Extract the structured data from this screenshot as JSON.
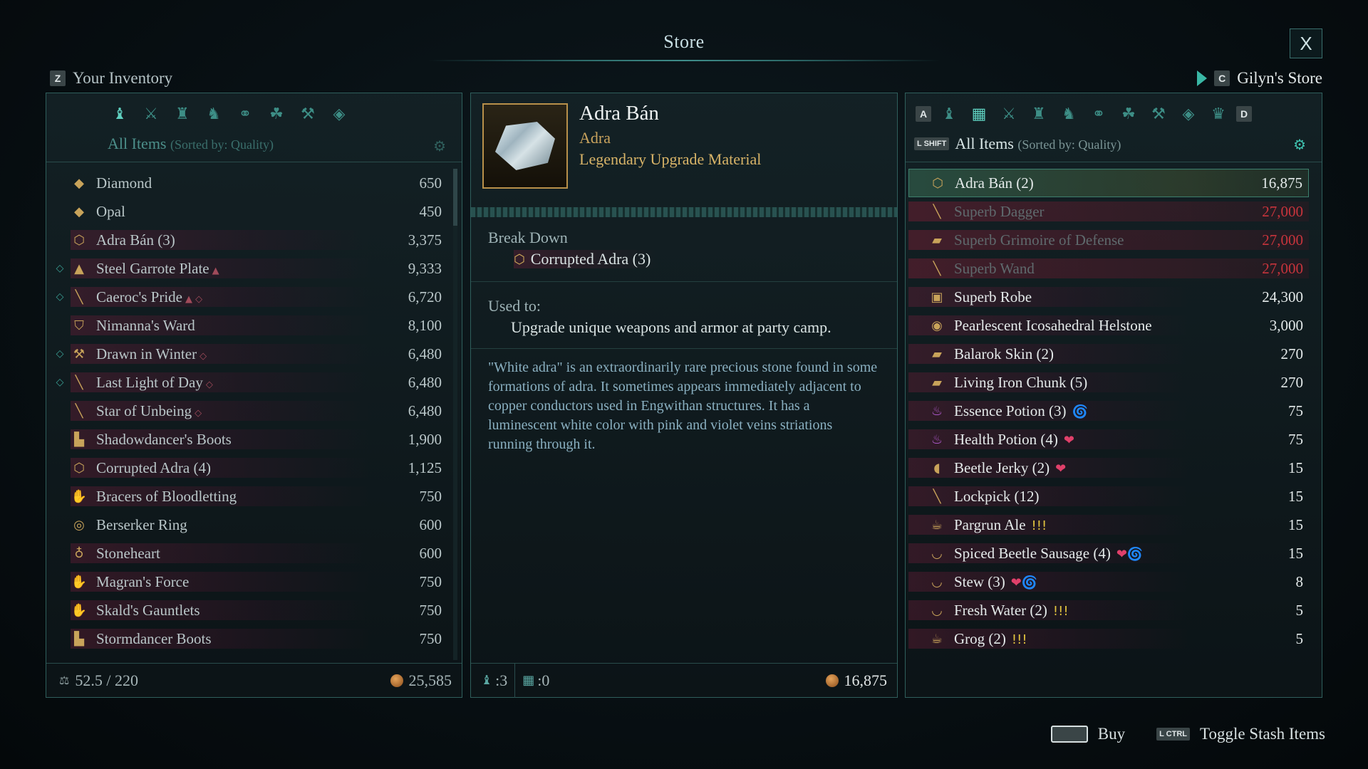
{
  "store": {
    "title": "Store",
    "close_label": "X"
  },
  "left": {
    "key": "Z",
    "title": "Your Inventory",
    "filter_label": "All Items",
    "sort_label": "(Sorted by: Quality)",
    "category_icons": [
      "bag-icon",
      "weapons-icon",
      "armor-icon",
      "boots-icon",
      "accessory-icon",
      "consumable-icon",
      "tool-icon",
      "gem-icon"
    ],
    "items": [
      {
        "icon": "gem-icon",
        "glyph": "◆",
        "name": "Diamond",
        "price": "650",
        "mark": "",
        "tag": "",
        "bg": false
      },
      {
        "icon": "gem-icon",
        "glyph": "◆",
        "name": "Opal",
        "price": "450",
        "mark": "",
        "tag": "",
        "bg": false
      },
      {
        "icon": "adra-icon",
        "glyph": "⬡",
        "name": "Adra Bán (3)",
        "price": "3,375",
        "mark": "",
        "tag": "",
        "bg": true
      },
      {
        "icon": "armor-icon",
        "glyph": "▲",
        "name": "Steel Garrote Plate",
        "price": "9,333",
        "mark": "◇",
        "tag": "▲",
        "bg": true
      },
      {
        "icon": "sword-icon",
        "glyph": "╲",
        "name": "Caeroc's Pride",
        "price": "6,720",
        "mark": "◇",
        "tag": "▲ ◇",
        "bg": true
      },
      {
        "icon": "shield-icon",
        "glyph": "⛉",
        "name": "Nimanna's Ward",
        "price": "8,100",
        "mark": "",
        "tag": "",
        "bg": true
      },
      {
        "icon": "hammer-icon",
        "glyph": "⚒",
        "name": "Drawn in Winter",
        "price": "6,480",
        "mark": "◇",
        "tag": "◇",
        "bg": true
      },
      {
        "icon": "sword-icon",
        "glyph": "╲",
        "name": "Last Light of Day",
        "price": "6,480",
        "mark": "◇",
        "tag": "◇",
        "bg": true
      },
      {
        "icon": "staff-icon",
        "glyph": "╲",
        "name": "Star of Unbeing",
        "price": "6,480",
        "mark": "",
        "tag": "◇",
        "bg": true
      },
      {
        "icon": "boots-icon",
        "glyph": "▙",
        "name": "Shadowdancer's Boots",
        "price": "1,900",
        "mark": "",
        "tag": "",
        "bg": true
      },
      {
        "icon": "adra-icon",
        "glyph": "⬡",
        "name": "Corrupted Adra (4)",
        "price": "1,125",
        "mark": "",
        "tag": "",
        "bg": true
      },
      {
        "icon": "bracers-icon",
        "glyph": "✋",
        "name": "Bracers of Bloodletting",
        "price": "750",
        "mark": "",
        "tag": "",
        "bg": true
      },
      {
        "icon": "ring-icon",
        "glyph": "◎",
        "name": "Berserker Ring",
        "price": "600",
        "mark": "",
        "tag": "",
        "bg": false
      },
      {
        "icon": "amulet-icon",
        "glyph": "♁",
        "name": "Stoneheart",
        "price": "600",
        "mark": "",
        "tag": "",
        "bg": true
      },
      {
        "icon": "gauntlet-icon",
        "glyph": "✋",
        "name": "Magran's Force",
        "price": "750",
        "mark": "",
        "tag": "",
        "bg": true
      },
      {
        "icon": "gauntlet-icon",
        "glyph": "✋",
        "name": "Skald's Gauntlets",
        "price": "750",
        "mark": "",
        "tag": "",
        "bg": true
      },
      {
        "icon": "boots-icon",
        "glyph": "▙",
        "name": "Stormdancer Boots",
        "price": "750",
        "mark": "",
        "tag": "",
        "bg": true
      }
    ],
    "weight": "52.5 / 220",
    "gold": "25,585"
  },
  "detail": {
    "name": "Adra Bán",
    "type": "Adra",
    "rarity": "Legendary Upgrade Material",
    "break_down_label": "Break Down",
    "break_down_item": "Corrupted Adra (3)",
    "used_to_label": "Used to:",
    "used_to_text": "Upgrade unique weapons and armor at party camp.",
    "description": "\"White adra\" is an extraordinarily rare precious stone found in some formations of adra. It sometimes appears immediately adjacent to copper conductors used in Engwithan structures. It has a luminescent white color with pink and violet veins striations running through it.",
    "bag_count": ":3",
    "stash_count": ":0",
    "price": "16,875"
  },
  "right": {
    "key": "C",
    "title": "Gilyn's Store",
    "key_a": "A",
    "key_d": "D",
    "shift_key": "L SHIFT",
    "filter_label": "All Items",
    "sort_label": "(Sorted by: Quality)",
    "category_icons": [
      "bag-icon",
      "chest-icon",
      "weapons-icon",
      "armor-icon",
      "boots-icon",
      "accessory-icon",
      "consumable-icon",
      "tool-icon",
      "gem-icon",
      "crown-icon"
    ],
    "items": [
      {
        "icon": "adra-icon",
        "glyph": "⬡",
        "name": "Adra Bán (2)",
        "price": "16,875",
        "dim": false,
        "red": false,
        "selected": true,
        "badges": ""
      },
      {
        "icon": "dagger-icon",
        "glyph": "╲",
        "name": "Superb Dagger",
        "price": "27,000",
        "dim": true,
        "red": true,
        "selected": false,
        "badges": ""
      },
      {
        "icon": "grimoire-icon",
        "glyph": "▰",
        "name": "Superb Grimoire of Defense",
        "price": "27,000",
        "dim": true,
        "red": true,
        "selected": false,
        "badges": ""
      },
      {
        "icon": "wand-icon",
        "glyph": "╲",
        "name": "Superb Wand",
        "price": "27,000",
        "dim": true,
        "red": true,
        "selected": false,
        "badges": ""
      },
      {
        "icon": "robe-icon",
        "glyph": "▣",
        "name": "Superb Robe",
        "price": "24,300",
        "dim": false,
        "red": false,
        "selected": false,
        "badges": ""
      },
      {
        "icon": "helmstone-icon",
        "glyph": "◉",
        "name": "Pearlescent Icosahedral Helstone",
        "price": "3,000",
        "dim": false,
        "red": false,
        "selected": false,
        "badges": ""
      },
      {
        "icon": "skin-icon",
        "glyph": "▰",
        "name": "Balarok Skin (2)",
        "price": "270",
        "dim": false,
        "red": false,
        "selected": false,
        "badges": ""
      },
      {
        "icon": "iron-icon",
        "glyph": "▰",
        "name": "Living Iron Chunk (5)",
        "price": "270",
        "dim": false,
        "red": false,
        "selected": false,
        "badges": ""
      },
      {
        "icon": "potion-icon",
        "glyph": "♨",
        "name": "Essence Potion (3)",
        "price": "75",
        "dim": false,
        "red": false,
        "selected": false,
        "badges": "🌀"
      },
      {
        "icon": "potion-icon",
        "glyph": "♨",
        "name": "Health Potion (4)",
        "price": "75",
        "dim": false,
        "red": false,
        "selected": false,
        "badges": "❤"
      },
      {
        "icon": "meat-icon",
        "glyph": "◖",
        "name": "Beetle Jerky (2)",
        "price": "15",
        "dim": false,
        "red": false,
        "selected": false,
        "badges": "❤"
      },
      {
        "icon": "lockpick-icon",
        "glyph": "╲",
        "name": "Lockpick (12)",
        "price": "15",
        "dim": false,
        "red": false,
        "selected": false,
        "badges": ""
      },
      {
        "icon": "ale-icon",
        "glyph": "☕",
        "name": "Pargrun Ale",
        "price": "15",
        "dim": false,
        "red": false,
        "selected": false,
        "badges": "!!!"
      },
      {
        "icon": "bowl-icon",
        "glyph": "◡",
        "name": "Spiced Beetle Sausage (4)",
        "price": "15",
        "dim": false,
        "red": false,
        "selected": false,
        "badges": "❤🌀"
      },
      {
        "icon": "bowl-icon",
        "glyph": "◡",
        "name": "Stew (3)",
        "price": "8",
        "dim": false,
        "red": false,
        "selected": false,
        "badges": "❤🌀"
      },
      {
        "icon": "cup-icon",
        "glyph": "◡",
        "name": "Fresh Water (2)",
        "price": "5",
        "dim": false,
        "red": false,
        "selected": false,
        "badges": "!!!"
      },
      {
        "icon": "ale-icon",
        "glyph": "☕",
        "name": "Grog (2)",
        "price": "5",
        "dim": false,
        "red": false,
        "selected": false,
        "badges": "!!!"
      }
    ]
  },
  "hints": {
    "buy_label": "Buy",
    "ctrl_key": "L CTRL",
    "toggle_label": "Toggle Stash Items"
  },
  "colors": {
    "accent": "#3f8d8a",
    "gold": "#c9a35d",
    "unaffordable": "#c8343c"
  }
}
